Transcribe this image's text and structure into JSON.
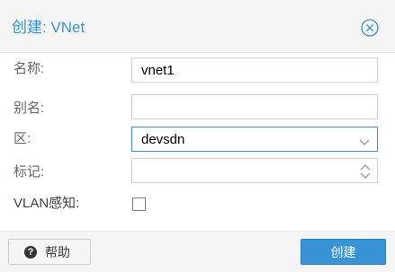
{
  "dialog": {
    "title": "创建: VNet",
    "close_icon": "close-circle-icon"
  },
  "form": {
    "name": {
      "label": "名称:",
      "value": "vnet1"
    },
    "alias": {
      "label": "别名:",
      "value": ""
    },
    "zone": {
      "label": "区:",
      "value": "devsdn",
      "icon": "chevron-down-icon"
    },
    "tag": {
      "label": "标记:",
      "value": "",
      "icon": "spinner-icon"
    },
    "vlan_aware": {
      "label": "VLAN感知:",
      "checked": false
    }
  },
  "footer": {
    "help_label": "帮助",
    "help_icon_glyph": "?",
    "create_label": "创建"
  },
  "colors": {
    "accent": "#3892d4",
    "header_bg": "#f5f5f5",
    "border": "#cfcfcf"
  }
}
